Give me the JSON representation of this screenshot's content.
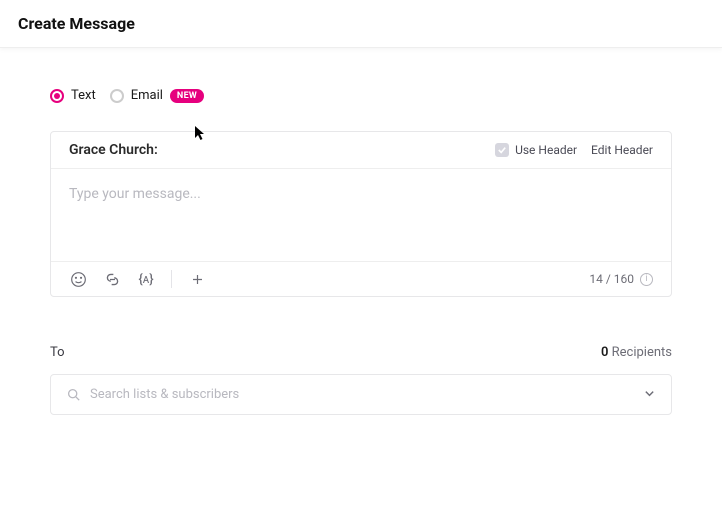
{
  "page": {
    "title": "Create Message"
  },
  "tabs": {
    "text_label": "Text",
    "email_label": "Email",
    "new_badge": "NEW"
  },
  "composer": {
    "sender": "Grace Church:",
    "use_header_label": "Use Header",
    "edit_header_label": "Edit Header",
    "placeholder": "Type your message...",
    "char_count": "14 / 160"
  },
  "to": {
    "label": "To",
    "count_value": "0",
    "count_label": "Recipients",
    "search_placeholder": "Search lists & subscribers"
  }
}
